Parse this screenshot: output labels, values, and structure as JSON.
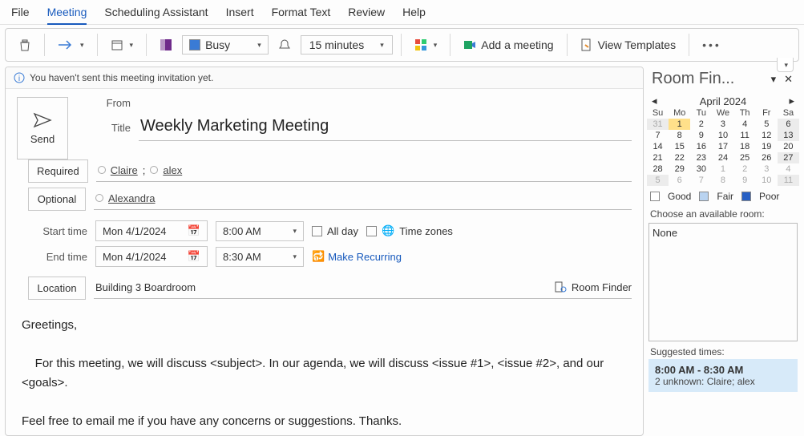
{
  "menu": [
    "File",
    "Meeting",
    "Scheduling Assistant",
    "Insert",
    "Format Text",
    "Review",
    "Help"
  ],
  "menu_active": 1,
  "toolbar": {
    "status": "Busy",
    "reminder": "15 minutes",
    "add_meeting": "Add a meeting",
    "view_templates": "View Templates"
  },
  "infobar": "You haven't sent this meeting invitation yet.",
  "send": "Send",
  "labels": {
    "from": "From",
    "title": "Title",
    "required": "Required",
    "optional": "Optional",
    "start": "Start time",
    "end": "End time",
    "location": "Location",
    "allday": "All day",
    "timezones": "Time zones",
    "recurring": "Make Recurring",
    "roomfinder": "Room Finder"
  },
  "meeting": {
    "title": "Weekly Marketing Meeting",
    "required": [
      "Claire",
      "alex"
    ],
    "optional": [
      "Alexandra"
    ],
    "start_date": "Mon 4/1/2024",
    "start_time": "8:00 AM",
    "end_date": "Mon 4/1/2024",
    "end_time": "8:30 AM",
    "location": "Building 3 Boardroom"
  },
  "body": {
    "greeting": "Greetings,",
    "p1": "    For this meeting, we will discuss <subject>. In our agenda, we will discuss <issue #1>, <issue #2>, and our <goals>.",
    "p2": "Feel free to email me if you have any concerns or suggestions. Thanks."
  },
  "roomfinder": {
    "title": "Room Fin...",
    "month": "April 2024",
    "dow": [
      "Su",
      "Mo",
      "Tu",
      "We",
      "Th",
      "Fr",
      "Sa"
    ],
    "weeks": [
      [
        {
          "d": "31",
          "dim": true,
          "shade": true
        },
        {
          "d": "1",
          "sel": true
        },
        {
          "d": "2"
        },
        {
          "d": "3"
        },
        {
          "d": "4"
        },
        {
          "d": "5"
        },
        {
          "d": "6",
          "shade": true
        }
      ],
      [
        {
          "d": "7"
        },
        {
          "d": "8"
        },
        {
          "d": "9"
        },
        {
          "d": "10"
        },
        {
          "d": "11"
        },
        {
          "d": "12"
        },
        {
          "d": "13",
          "shade": true
        }
      ],
      [
        {
          "d": "14"
        },
        {
          "d": "15"
        },
        {
          "d": "16"
        },
        {
          "d": "17"
        },
        {
          "d": "18"
        },
        {
          "d": "19"
        },
        {
          "d": "20"
        }
      ],
      [
        {
          "d": "21"
        },
        {
          "d": "22"
        },
        {
          "d": "23"
        },
        {
          "d": "24"
        },
        {
          "d": "25"
        },
        {
          "d": "26"
        },
        {
          "d": "27",
          "shade": true
        }
      ],
      [
        {
          "d": "28"
        },
        {
          "d": "29"
        },
        {
          "d": "30"
        },
        {
          "d": "1",
          "dim": true
        },
        {
          "d": "2",
          "dim": true
        },
        {
          "d": "3",
          "dim": true
        },
        {
          "d": "4",
          "dim": true
        }
      ],
      [
        {
          "d": "5",
          "dim": true,
          "shade": true
        },
        {
          "d": "6",
          "dim": true
        },
        {
          "d": "7",
          "dim": true
        },
        {
          "d": "8",
          "dim": true
        },
        {
          "d": "9",
          "dim": true
        },
        {
          "d": "10",
          "dim": true
        },
        {
          "d": "11",
          "dim": true,
          "shade": true
        }
      ]
    ],
    "legend": {
      "good": "Good",
      "fair": "Fair",
      "poor": "Poor"
    },
    "choose": "Choose an available room:",
    "room": "None",
    "suggested": "Suggested times:",
    "sugg_time": "8:00 AM - 8:30 AM",
    "sugg_sub": "2 unknown: Claire; alex"
  }
}
